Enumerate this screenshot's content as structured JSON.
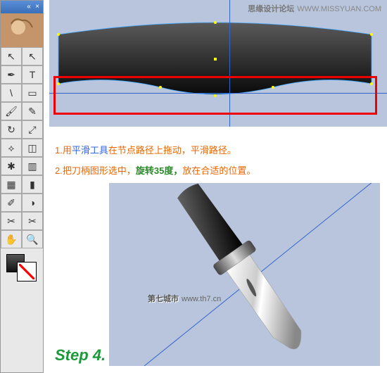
{
  "watermark_top": {
    "label": "思缘设计论坛",
    "url": "WWW.MISSYUAN.COM"
  },
  "watermark_mid": {
    "label": "第七城市",
    "url": "www.th7.cn"
  },
  "step": "Step 4.",
  "instructions": {
    "line1_num": "1.",
    "line1_a": "用",
    "line1_tool": "平滑工具",
    "line1_b": "在节点路径上拖动，平滑路径。",
    "line2_num": "2.",
    "line2_a": "把刀柄图形选中，",
    "line2_green": "旋转35度，",
    "line2_b": "放在合适的位置。"
  },
  "tools": [
    {
      "name": "selection",
      "glyph": "↖"
    },
    {
      "name": "direct-select",
      "glyph": "↖"
    },
    {
      "name": "pen",
      "glyph": "✒"
    },
    {
      "name": "type",
      "glyph": "T"
    },
    {
      "name": "line",
      "glyph": "\\"
    },
    {
      "name": "rectangle",
      "glyph": "▭"
    },
    {
      "name": "brush",
      "glyph": "🖌"
    },
    {
      "name": "pencil",
      "glyph": "✎"
    },
    {
      "name": "rotate",
      "glyph": "↻"
    },
    {
      "name": "scale",
      "glyph": "⤢"
    },
    {
      "name": "warp",
      "glyph": "⟡"
    },
    {
      "name": "free-transform",
      "glyph": "◫"
    },
    {
      "name": "symbol-spray",
      "glyph": "✱"
    },
    {
      "name": "graph",
      "glyph": "▥"
    },
    {
      "name": "mesh",
      "glyph": "▦"
    },
    {
      "name": "gradient",
      "glyph": "▮"
    },
    {
      "name": "eyedropper",
      "glyph": "✐"
    },
    {
      "name": "blend",
      "glyph": "◑"
    },
    {
      "name": "slice",
      "glyph": "✂"
    },
    {
      "name": "scissors",
      "glyph": "✂"
    },
    {
      "name": "hand",
      "glyph": "✋"
    },
    {
      "name": "zoom",
      "glyph": "🔍"
    }
  ]
}
